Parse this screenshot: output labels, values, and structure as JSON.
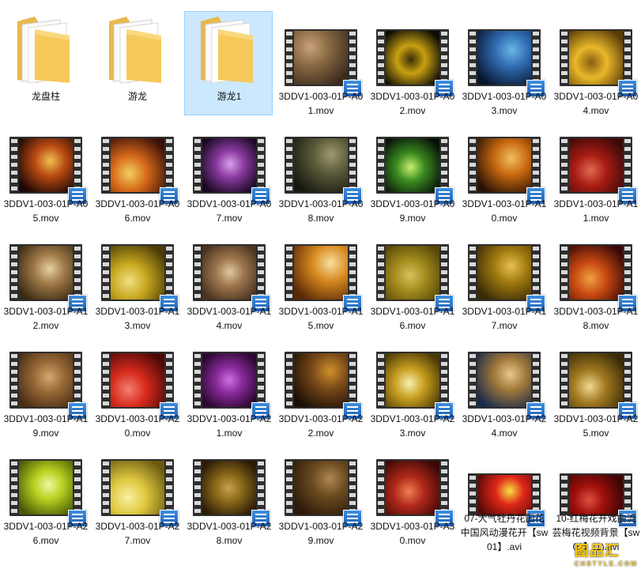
{
  "folders": [
    {
      "name": "龙盘柱",
      "selected": false
    },
    {
      "name": "游龙",
      "selected": false
    },
    {
      "name": "游龙1",
      "selected": true
    }
  ],
  "videos": [
    {
      "name": "3DDV1-003-01P-A01.mov",
      "colors": [
        "#3a2a1e",
        "#8a6a44",
        "#c8a27a"
      ]
    },
    {
      "name": "3DDV1-003-01P-A02.mov",
      "colors": [
        "#0b0b05",
        "#c8a012",
        "#3a2c08"
      ]
    },
    {
      "name": "3DDV1-003-01P-A03.mov",
      "colors": [
        "#08162e",
        "#2f6bb0",
        "#6ab6e8"
      ]
    },
    {
      "name": "3DDV1-003-01P-A04.mov",
      "colors": [
        "#5a3b06",
        "#e8b82a",
        "#8a5d10"
      ]
    },
    {
      "name": "3DDV1-003-01P-A05.mov",
      "colors": [
        "#1a0604",
        "#b84a12",
        "#f0c050"
      ]
    },
    {
      "name": "3DDV1-003-01P-A06.mov",
      "colors": [
        "#3a1008",
        "#d86a1a",
        "#f0d060"
      ]
    },
    {
      "name": "3DDV1-003-01P-A07.mov",
      "colors": [
        "#180820",
        "#8a3aa0",
        "#d8a0e8"
      ]
    },
    {
      "name": "3DDV1-003-01P-A08.mov",
      "colors": [
        "#181810",
        "#5a5a3a",
        "#a09a70"
      ]
    },
    {
      "name": "3DDV1-003-01P-A09.mov",
      "colors": [
        "#081008",
        "#3a8a20",
        "#c8f070"
      ]
    },
    {
      "name": "3DDV1-003-01P-A10.mov",
      "colors": [
        "#2a1004",
        "#c86a10",
        "#f0c060"
      ]
    },
    {
      "name": "3DDV1-003-01P-A11.mov",
      "colors": [
        "#3a0808",
        "#a81c14",
        "#e06a50"
      ]
    },
    {
      "name": "3DDV1-003-01P-A12.mov",
      "colors": [
        "#3a2a14",
        "#a07a48",
        "#e8d0a0"
      ]
    },
    {
      "name": "3DDV1-003-01P-A13.mov",
      "colors": [
        "#4a3a06",
        "#c8a820",
        "#f0e080"
      ]
    },
    {
      "name": "3DDV1-003-01P-A14.mov",
      "colors": [
        "#4a3420",
        "#a07850",
        "#e0c8a0"
      ]
    },
    {
      "name": "3DDV1-003-01P-A15.mov",
      "colors": [
        "#5a2806",
        "#d88a20",
        "#f8e0a0"
      ]
    },
    {
      "name": "3DDV1-003-01P-A16.mov",
      "colors": [
        "#5a4a08",
        "#a89020",
        "#d8c060"
      ]
    },
    {
      "name": "3DDV1-003-01P-A17.mov",
      "colors": [
        "#3a2a06",
        "#a07a10",
        "#e8c050"
      ]
    },
    {
      "name": "3DDV1-003-01P-A18.mov",
      "colors": [
        "#3a0806",
        "#c84a12",
        "#f0a040"
      ]
    },
    {
      "name": "3DDV1-003-01P-A19.mov",
      "colors": [
        "#4a2e14",
        "#9a6a38",
        "#d8a870"
      ]
    },
    {
      "name": "3DDV1-003-01P-A20.mov",
      "colors": [
        "#4a0806",
        "#d82a1c",
        "#f08070"
      ]
    },
    {
      "name": "3DDV1-003-01P-A21.mov",
      "colors": [
        "#2a0830",
        "#8a2a9a",
        "#d070e0"
      ]
    },
    {
      "name": "3DDV1-003-01P-A22.mov",
      "colors": [
        "#1a0e04",
        "#7a4a1a",
        "#d0902a"
      ]
    },
    {
      "name": "3DDV1-003-01P-A23.mov",
      "colors": [
        "#4a3806",
        "#c8a020",
        "#f8f0b0"
      ]
    },
    {
      "name": "3DDV1-003-01P-A24.mov",
      "colors": [
        "#1a2a4a",
        "#a0783a",
        "#e8c890"
      ]
    },
    {
      "name": "3DDV1-003-01P-A25.mov",
      "colors": [
        "#3a2a06",
        "#a07820",
        "#f0d890"
      ]
    },
    {
      "name": "3DDV1-003-01P-A26.mov",
      "colors": [
        "#4a5a06",
        "#b8d020",
        "#f0f8a0"
      ]
    },
    {
      "name": "3DDV1-003-01P-A27.mov",
      "colors": [
        "#6a5a10",
        "#e0c840",
        "#f8f0a0"
      ]
    },
    {
      "name": "3DDV1-003-01P-A28.mov",
      "colors": [
        "#2a1a06",
        "#8a6a1a",
        "#c8a050"
      ]
    },
    {
      "name": "3DDV1-003-01P-A29.mov",
      "colors": [
        "#2a1a08",
        "#6a4a20",
        "#b08850"
      ]
    },
    {
      "name": "3DDV1-003-01P-A30.mov",
      "colors": [
        "#3a0806",
        "#b0281a",
        "#f08050"
      ]
    },
    {
      "name": "07-大气牡丹花国花中国风动漫花开【sw01】.avi",
      "colors": [
        "#5a0a06",
        "#e0281a",
        "#f8e040"
      ]
    },
    {
      "name": "10-红梅花开戏曲流芸梅花视频背景【sw01】(1).avi",
      "colors": [
        "#3a0404",
        "#a0100c",
        "#e05040"
      ]
    }
  ],
  "watermark": {
    "text": "图品汇",
    "sub": "CHSTYLE.COM"
  },
  "icons": {
    "folder": "folder-icon",
    "video_badge": "video-file-badge-icon"
  }
}
